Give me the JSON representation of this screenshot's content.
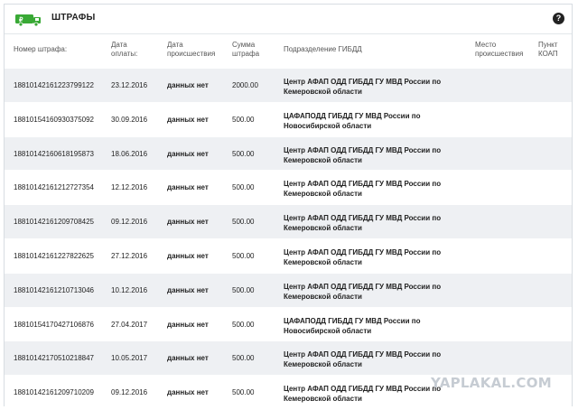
{
  "header": {
    "title": "ШТРАФЫ",
    "help_label": "?"
  },
  "columns": {
    "fine_number": "Номер штрафа:",
    "payment_date": [
      "Дата",
      "оплаты:"
    ],
    "incident_date": [
      "Дата",
      "происшествия"
    ],
    "amount": [
      "Сумма",
      "штрафа"
    ],
    "division": "Подразделение ГИБДД",
    "place": [
      "Место",
      "происшествия"
    ],
    "koap": [
      "Пункт",
      "КОАП"
    ]
  },
  "rows": [
    {
      "fine": "18810142161223799122",
      "pay": "23.12.2016",
      "inc": "данных нет",
      "amt": "2000.00",
      "div": [
        "Центр АФАП ОДД ГИБДД ГУ МВД России по",
        "Кемеровской области"
      ]
    },
    {
      "fine": "18810154160930375092",
      "pay": "30.09.2016",
      "inc": "данных нет",
      "amt": "500.00",
      "div": [
        "ЦАФАПОДД ГИБДД ГУ МВД России по",
        "Новосибирской области"
      ]
    },
    {
      "fine": "18810142160618195873",
      "pay": "18.06.2016",
      "inc": "данных нет",
      "amt": "500.00",
      "div": [
        "Центр АФАП ОДД ГИБДД ГУ МВД России по",
        "Кемеровской области"
      ]
    },
    {
      "fine": "18810142161212727354",
      "pay": "12.12.2016",
      "inc": "данных нет",
      "amt": "500.00",
      "div": [
        "Центр АФАП ОДД ГИБДД ГУ МВД России по",
        "Кемеровской области"
      ]
    },
    {
      "fine": "18810142161209708425",
      "pay": "09.12.2016",
      "inc": "данных нет",
      "amt": "500.00",
      "div": [
        "Центр АФАП ОДД ГИБДД ГУ МВД России по",
        "Кемеровской области"
      ]
    },
    {
      "fine": "18810142161227822625",
      "pay": "27.12.2016",
      "inc": "данных нет",
      "amt": "500.00",
      "div": [
        "Центр АФАП ОДД ГИБДД ГУ МВД России по",
        "Кемеровской области"
      ]
    },
    {
      "fine": "18810142161210713046",
      "pay": "10.12.2016",
      "inc": "данных нет",
      "amt": "500.00",
      "div": [
        "Центр АФАП ОДД ГИБДД ГУ МВД России по",
        "Кемеровской области"
      ]
    },
    {
      "fine": "18810154170427106876",
      "pay": "27.04.2017",
      "inc": "данных нет",
      "amt": "500.00",
      "div": [
        "ЦАФАПОДД ГИБДД ГУ МВД России по",
        "Новосибирской области"
      ]
    },
    {
      "fine": "18810142170510218847",
      "pay": "10.05.2017",
      "inc": "данных нет",
      "amt": "500.00",
      "div": [
        "Центр АФАП ОДД ГИБДД ГУ МВД России по",
        "Кемеровской области"
      ]
    },
    {
      "fine": "18810142161209710209",
      "pay": "09.12.2016",
      "inc": "данных нет",
      "amt": "500.00",
      "div": [
        "Центр АФАП ОДД ГИБДД ГУ МВД России по",
        "Кемеровской области"
      ]
    }
  ],
  "watermark": "YAPLAKAL.COM",
  "colors": {
    "logo_green": "#39a935",
    "row_alt": "#eef0f3",
    "help_bg": "#222222"
  }
}
